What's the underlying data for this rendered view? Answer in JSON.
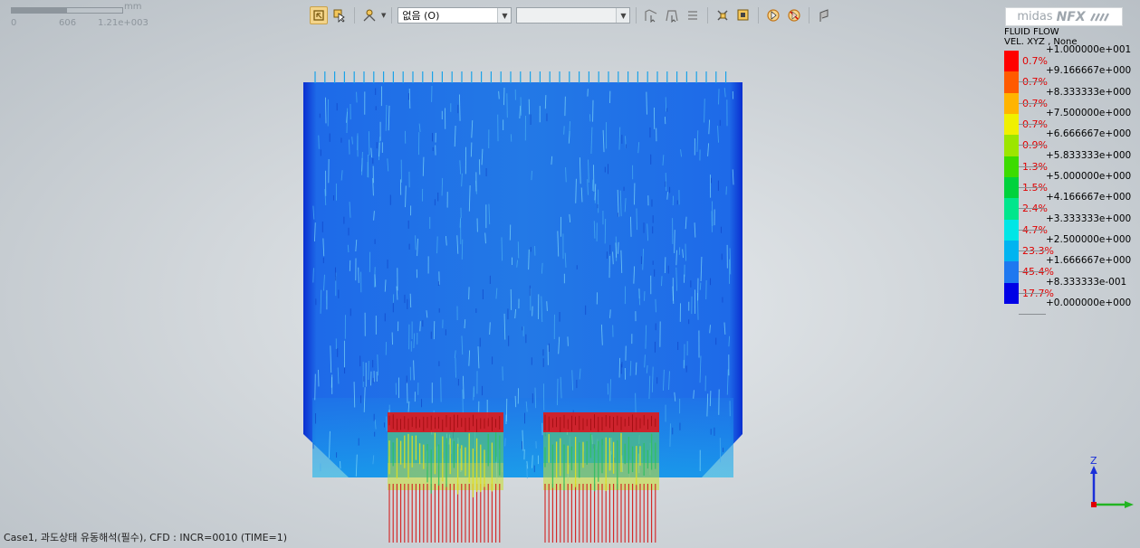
{
  "scalebar": {
    "unit": "mm",
    "ticks": [
      "0",
      "606",
      "1.21e+003"
    ]
  },
  "toolbar": {
    "combo1_value": "없음 (O)",
    "combo2_value": ""
  },
  "logo": {
    "midas": "midas",
    "nfx": "NFX"
  },
  "legend": {
    "title": "FLUID FLOW",
    "subtitle": "VEL. XYZ , None",
    "bands": [
      {
        "color": "#ff0000",
        "pct": "0.7%"
      },
      {
        "color": "#ff5a00",
        "pct": "0.7%"
      },
      {
        "color": "#ffb400",
        "pct": "0.7%"
      },
      {
        "color": "#f0f000",
        "pct": "0.7%"
      },
      {
        "color": "#9ce600",
        "pct": "0.9%"
      },
      {
        "color": "#3cdc00",
        "pct": "1.3%"
      },
      {
        "color": "#00d23c",
        "pct": "1.5%"
      },
      {
        "color": "#00e68c",
        "pct": "2.4%"
      },
      {
        "color": "#00e6e6",
        "pct": "4.7%"
      },
      {
        "color": "#00b4f0",
        "pct": "23.3%"
      },
      {
        "color": "#1e78f0",
        "pct": "45.4%"
      },
      {
        "color": "#0000e6",
        "pct": "17.7%"
      }
    ],
    "values": [
      "+1.000000e+001",
      "+9.166667e+000",
      "+8.333333e+000",
      "+7.500000e+000",
      "+6.666667e+000",
      "+5.833333e+000",
      "+5.000000e+000",
      "+4.166667e+000",
      "+3.333333e+000",
      "+2.500000e+000",
      "+1.666667e+000",
      "+8.333333e-001",
      "+0.000000e+000"
    ]
  },
  "axis": {
    "z": "Z"
  },
  "status": "Case1,  과도상태 유동해석(필수),  CFD : INCR=0010 (TIME=1)"
}
